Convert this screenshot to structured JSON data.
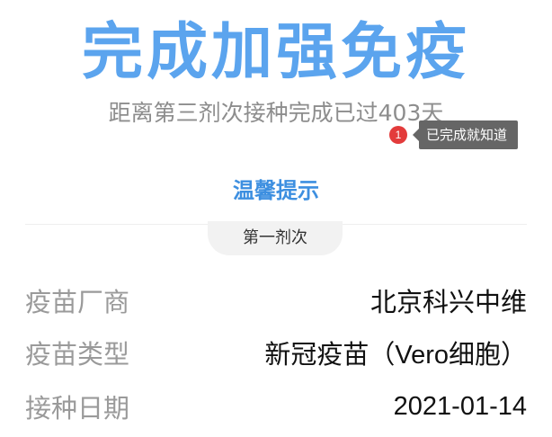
{
  "header": {
    "title": "完成加强免疫",
    "subtitle": "距离第三剂次接种完成已过403天"
  },
  "tooltip": {
    "badge": "1",
    "text": "已完成就知道"
  },
  "tips": {
    "label": "温馨提示"
  },
  "dose": {
    "tab_label": "第一剂次",
    "rows": [
      {
        "label": "疫苗厂商",
        "value": "北京科兴中维"
      },
      {
        "label": "疫苗类型",
        "value": "新冠疫苗（Vero细胞）"
      },
      {
        "label": "接种日期",
        "value": "2021-01-14"
      }
    ]
  },
  "colors": {
    "title": "#5ba4ee",
    "link": "#3d8fe0",
    "badge": "#e33b3b",
    "tooltip_bg": "#666666"
  }
}
